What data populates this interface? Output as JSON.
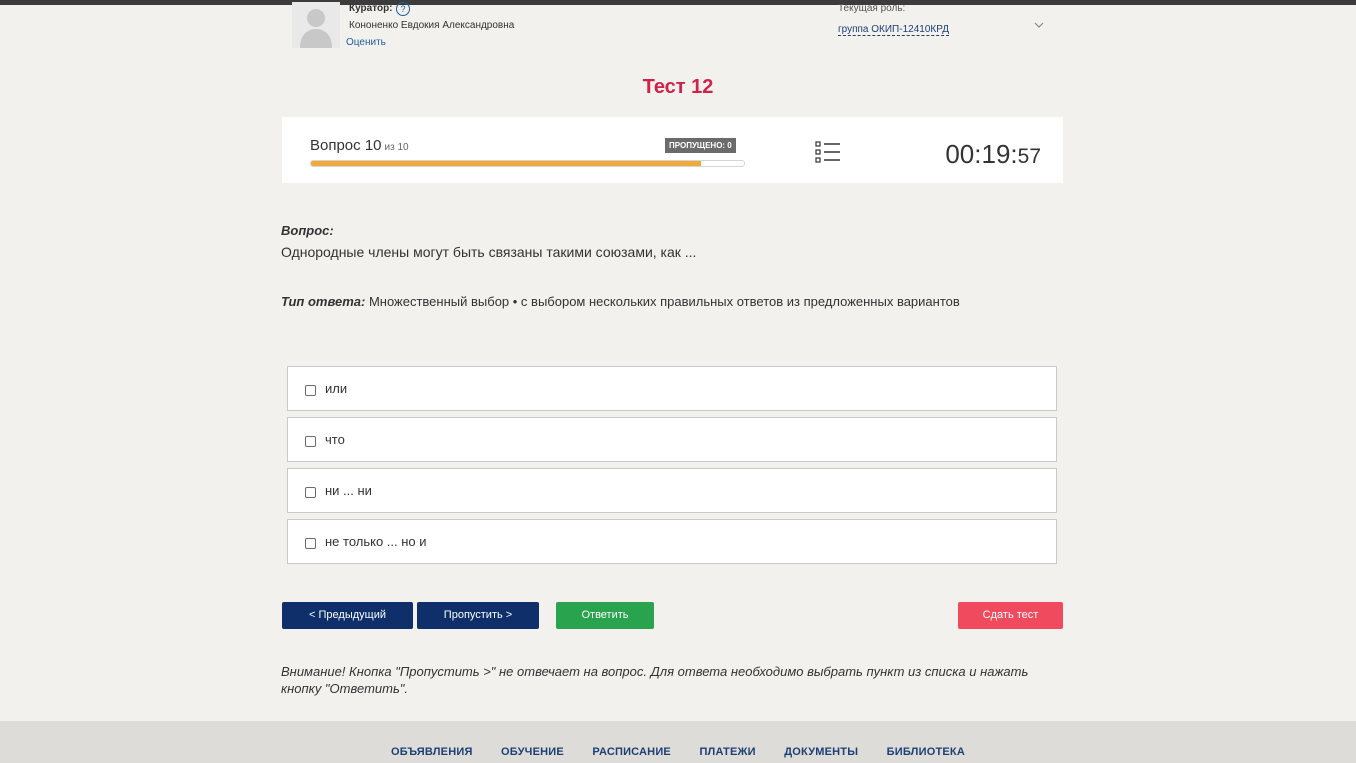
{
  "header": {
    "curator_label": "Куратор:",
    "help_symbol": "?",
    "curator_name": "Кононенко Евдокия Александровна",
    "rate_link": "Оценить",
    "role_label": "Текущая роль:",
    "role_value": "группа ОКИП-12410КРД",
    "icons": [
      "avatar",
      "question-circle-icon",
      "chevron-down-icon"
    ]
  },
  "test": {
    "title": "Тест 12"
  },
  "progress": {
    "question_label": "Вопрос 10",
    "of_label": "из 10",
    "skipped_badge": "ПРОПУЩЕНО: 0",
    "fill_fraction": 0.9,
    "fill_color": "#f0a93b",
    "timer_main": "00:19:",
    "timer_seconds": "57",
    "icons": [
      "question-list-icon"
    ]
  },
  "question": {
    "heading": "Вопрос:",
    "text": "Однородные члены могут быть связаны такими союзами, как ...",
    "answer_type_label": "Тип ответа:",
    "answer_type_value": "Множественный выбор • с выбором нескольких правильных ответов из предложенных вариантов"
  },
  "options": [
    {
      "label": "или",
      "checked": false
    },
    {
      "label": "что",
      "checked": false
    },
    {
      "label": "ни ... ни",
      "checked": false
    },
    {
      "label": "не только ... но и",
      "checked": false
    }
  ],
  "buttons": {
    "prev": "< Предыдущий",
    "skip": "Пропустить >",
    "answer": "Ответить",
    "submit": "Сдать тест"
  },
  "colors": {
    "title": "#d0234a",
    "nav_button": "#0e2f6a",
    "answer_button": "#2aa34f",
    "submit_button": "#ef4a5d"
  },
  "warning": "Внимание! Кнопка \"Пропустить >\" не отвечает на вопрос. Для ответа необходимо выбрать пункт из списка и нажать кнопку \"Ответить\".",
  "footer": {
    "nav": [
      "ОБЪЯВЛЕНИЯ",
      "ОБУЧЕНИЕ",
      "РАСПИСАНИЕ",
      "ПЛАТЕЖИ",
      "ДОКУМЕНТЫ",
      "БИБЛИОТЕКА"
    ]
  }
}
